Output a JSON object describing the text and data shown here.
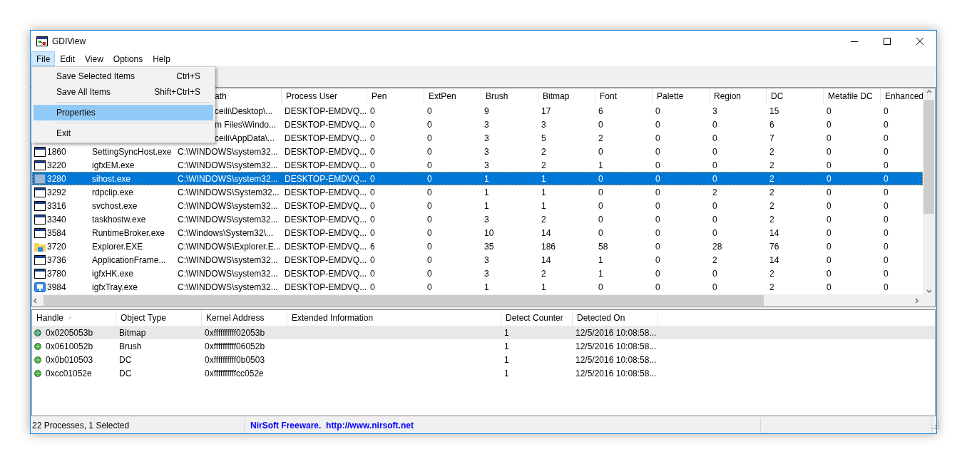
{
  "window": {
    "title": "GDIView"
  },
  "menubar": [
    {
      "label": "File",
      "selected": true
    },
    {
      "label": "Edit",
      "selected": false
    },
    {
      "label": "View",
      "selected": false
    },
    {
      "label": "Options",
      "selected": false
    },
    {
      "label": "Help",
      "selected": false
    }
  ],
  "menu": [
    {
      "kind": "item",
      "label": "Save Selected Items",
      "shortcut": "Ctrl+S",
      "selected": false
    },
    {
      "kind": "item",
      "label": "Save All Items",
      "shortcut": "Shift+Ctrl+S",
      "selected": false
    },
    {
      "kind": "separator"
    },
    {
      "kind": "item",
      "label": "Properties",
      "selected": true
    },
    {
      "kind": "separator"
    },
    {
      "kind": "item",
      "label": "Exit",
      "selected": false
    }
  ],
  "processes": {
    "columns": [
      "ath",
      "Process User",
      "Pen",
      "ExtPen",
      "Brush",
      "Bitmap",
      "Font",
      "Palette",
      "Region",
      "DC",
      "Metafile DC",
      "Enhanced"
    ],
    "rows": [
      {
        "path": "ceili\\Desktop\\...",
        "user": "DESKTOP-EMDVQ...",
        "values": [
          "0",
          "0",
          "9",
          "17",
          "6",
          "0",
          "3",
          "15",
          "0",
          "0"
        ],
        "selected": false
      },
      {
        "path": "m Files\\Windo...",
        "user": "DESKTOP-EMDVQ...",
        "values": [
          "0",
          "0",
          "3",
          "3",
          "0",
          "0",
          "0",
          "6",
          "0",
          "0"
        ],
        "selected": false
      },
      {
        "path": "ceili\\AppData\\...",
        "user": "DESKTOP-EMDVQ...",
        "values": [
          "0",
          "0",
          "3",
          "5",
          "2",
          "0",
          "0",
          "7",
          "0",
          "0"
        ],
        "selected": false
      },
      {
        "pid": "1860",
        "name": "SettingSyncHost.exe",
        "path": "C:\\WINDOWS\\system32...",
        "user": "DESKTOP-EMDVQ...",
        "values": [
          "0",
          "0",
          "3",
          "2",
          "0",
          "0",
          "0",
          "2",
          "0",
          "0"
        ],
        "selected": false
      },
      {
        "pid": "3220",
        "name": "igfxEM.exe",
        "path": "C:\\WINDOWS\\system32...",
        "user": "DESKTOP-EMDVQ...",
        "values": [
          "0",
          "0",
          "3",
          "2",
          "1",
          "0",
          "0",
          "2",
          "0",
          "0"
        ],
        "selected": false
      },
      {
        "pid": "3280",
        "name": "sihost.exe",
        "path": "C:\\WINDOWS\\system32...",
        "user": "DESKTOP-EMDVQ...",
        "values": [
          "0",
          "0",
          "1",
          "1",
          "0",
          "0",
          "0",
          "2",
          "0",
          "0"
        ],
        "selected": true
      },
      {
        "pid": "3292",
        "name": "rdpclip.exe",
        "path": "C:\\WINDOWS\\System32...",
        "user": "DESKTOP-EMDVQ...",
        "values": [
          "0",
          "0",
          "1",
          "1",
          "0",
          "0",
          "2",
          "2",
          "0",
          "0"
        ],
        "selected": false
      },
      {
        "pid": "3316",
        "name": "svchost.exe",
        "path": "C:\\WINDOWS\\system32...",
        "user": "DESKTOP-EMDVQ...",
        "values": [
          "0",
          "0",
          "1",
          "1",
          "0",
          "0",
          "0",
          "2",
          "0",
          "0"
        ],
        "selected": false
      },
      {
        "pid": "3340",
        "name": "taskhostw.exe",
        "path": "C:\\WINDOWS\\system32...",
        "user": "DESKTOP-EMDVQ...",
        "values": [
          "0",
          "0",
          "3",
          "2",
          "0",
          "0",
          "0",
          "2",
          "0",
          "0"
        ],
        "selected": false
      },
      {
        "pid": "3584",
        "name": "RuntimeBroker.exe",
        "path": "C:\\Windows\\System32\\...",
        "user": "DESKTOP-EMDVQ...",
        "values": [
          "0",
          "0",
          "10",
          "14",
          "0",
          "0",
          "0",
          "14",
          "0",
          "0"
        ],
        "selected": false
      },
      {
        "kind": "folder",
        "pid": "3720",
        "name": "Explorer.EXE",
        "path": "C:\\WINDOWS\\Explorer.E...",
        "user": "DESKTOP-EMDVQ...",
        "values": [
          "6",
          "0",
          "35",
          "186",
          "58",
          "0",
          "28",
          "76",
          "0",
          "0"
        ],
        "selected": false
      },
      {
        "pid": "3736",
        "name": "ApplicationFrame...",
        "path": "C:\\WINDOWS\\system32...",
        "user": "DESKTOP-EMDVQ...",
        "values": [
          "0",
          "0",
          "3",
          "14",
          "1",
          "0",
          "2",
          "14",
          "0",
          "0"
        ],
        "selected": false
      },
      {
        "pid": "3780",
        "name": "igfxHK.exe",
        "path": "C:\\WINDOWS\\system32...",
        "user": "DESKTOP-EMDVQ...",
        "values": [
          "0",
          "0",
          "3",
          "2",
          "1",
          "0",
          "0",
          "2",
          "0",
          "0"
        ],
        "selected": false
      },
      {
        "kind": "monitor",
        "pid": "3984",
        "name": "igfxTray.exe",
        "path": "C:\\WINDOWS\\system32...",
        "user": "DESKTOP-EMDVQ...",
        "values": [
          "0",
          "0",
          "1",
          "1",
          "0",
          "0",
          "0",
          "2",
          "0",
          "0"
        ],
        "selected": false
      }
    ]
  },
  "objects": {
    "columns": [
      "Handle",
      "Object Type",
      "Kernel Address",
      "Extended Information",
      "Detect Counter",
      "Detected On"
    ],
    "rows": [
      {
        "cells": [
          "0x0205053b",
          "Bitmap",
          "0xffffffffff02053b",
          "",
          "1",
          "12/5/2016 10:08:58..."
        ],
        "selected": true
      },
      {
        "cells": [
          "0x0610052b",
          "Brush",
          "0xffffffffff06052b",
          "",
          "1",
          "12/5/2016 10:08:58..."
        ],
        "selected": false
      },
      {
        "cells": [
          "0x0b010503",
          "DC",
          "0xffffffffff0b0503",
          "",
          "1",
          "12/5/2016 10:08:58..."
        ],
        "selected": false
      },
      {
        "cells": [
          "0xcc01052e",
          "DC",
          "0xffffffffffcc052e",
          "",
          "1",
          "12/5/2016 10:08:58..."
        ],
        "selected": false
      }
    ]
  },
  "status_bar": {
    "count": "22 Processes, 1 Selected",
    "vendor": "NirSoft Freeware.",
    "link": "http://www.nirsoft.net"
  }
}
